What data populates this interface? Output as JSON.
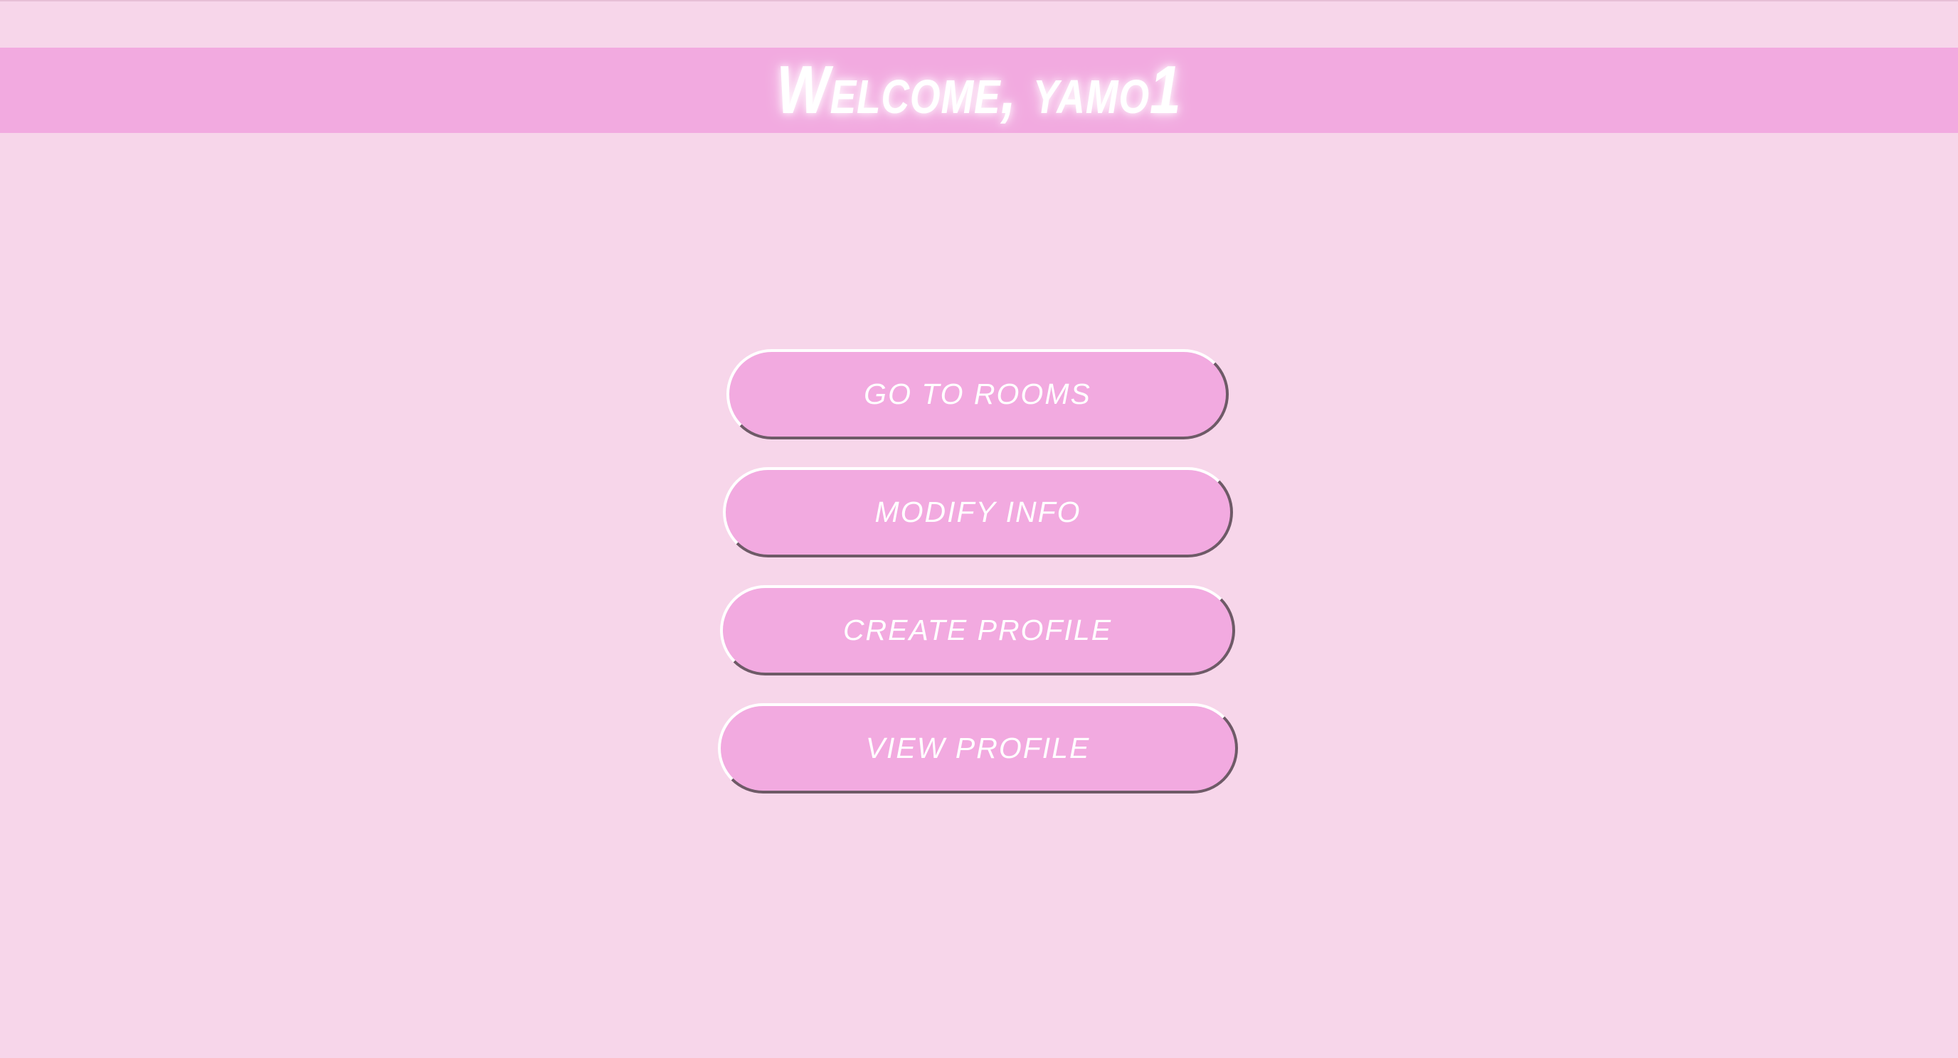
{
  "header": {
    "title": "Welcome, yamo1"
  },
  "menu": {
    "buttons": [
      {
        "label": "GO TO ROOMS"
      },
      {
        "label": "MODIFY INFO"
      },
      {
        "label": "CREATE PROFILE"
      },
      {
        "label": "VIEW PROFILE"
      }
    ]
  },
  "colors": {
    "background": "#f7d6ea",
    "accent": "#f2aae0",
    "text": "#ffffff",
    "button_shadow_border": "#6e5a67"
  }
}
